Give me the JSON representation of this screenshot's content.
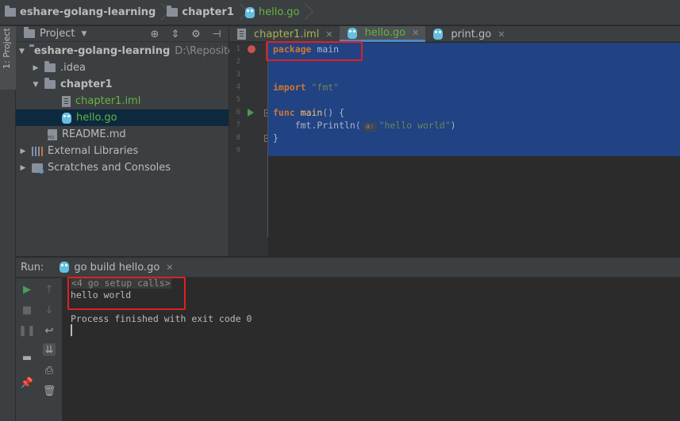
{
  "breadcrumb": {
    "project": "eshare-golang-learning",
    "folder": "chapter1",
    "file": "hello.go"
  },
  "left_strip": {
    "tab_label": "1: Project"
  },
  "project_panel": {
    "title": "Project",
    "tree": [
      {
        "name": "eshare-golang-learning",
        "path": "D:\\Repository",
        "kind": "folder",
        "expanded": true
      },
      {
        "name": ".idea",
        "kind": "folder",
        "expanded": false
      },
      {
        "name": "chapter1",
        "kind": "folder",
        "expanded": true
      },
      {
        "name": "chapter1.iml",
        "kind": "iml-file"
      },
      {
        "name": "hello.go",
        "kind": "go-file",
        "selected": true
      },
      {
        "name": "README.md",
        "kind": "md-file"
      },
      {
        "name": "External Libraries",
        "kind": "library"
      },
      {
        "name": "Scratches and Consoles",
        "kind": "scratch"
      }
    ]
  },
  "editor": {
    "tabs": [
      {
        "label": "chapter1.iml",
        "active": false
      },
      {
        "label": "hello.go",
        "active": true
      },
      {
        "label": "print.go",
        "active": false
      }
    ],
    "line_numbers": [
      "1",
      "2",
      "3",
      "4",
      "5",
      "6",
      "7",
      "8",
      "9"
    ],
    "code": {
      "l1_kw": "package",
      "l1_rest": " main",
      "l4_kw": "import",
      "l4_str": "\"fmt\"",
      "l6_kw": "func",
      "l6_fn": "main",
      "l6_rest": "() {",
      "l7_call": "    fmt.Println(",
      "l7_hint": "a:",
      "l7_str": "\"hello world\"",
      "l7_end": ")",
      "l8": "}"
    }
  },
  "run_panel": {
    "label": "Run:",
    "tab_label": "go build hello.go",
    "console": {
      "setup": "<4 go setup calls>",
      "output": "hello world",
      "exit": "Process finished with exit code 0"
    }
  },
  "colors": {
    "selection": "#214283",
    "keyword": "#cc7832",
    "string": "#6a8759",
    "highlight_box": "#e02020",
    "run_green": "#499c54"
  }
}
